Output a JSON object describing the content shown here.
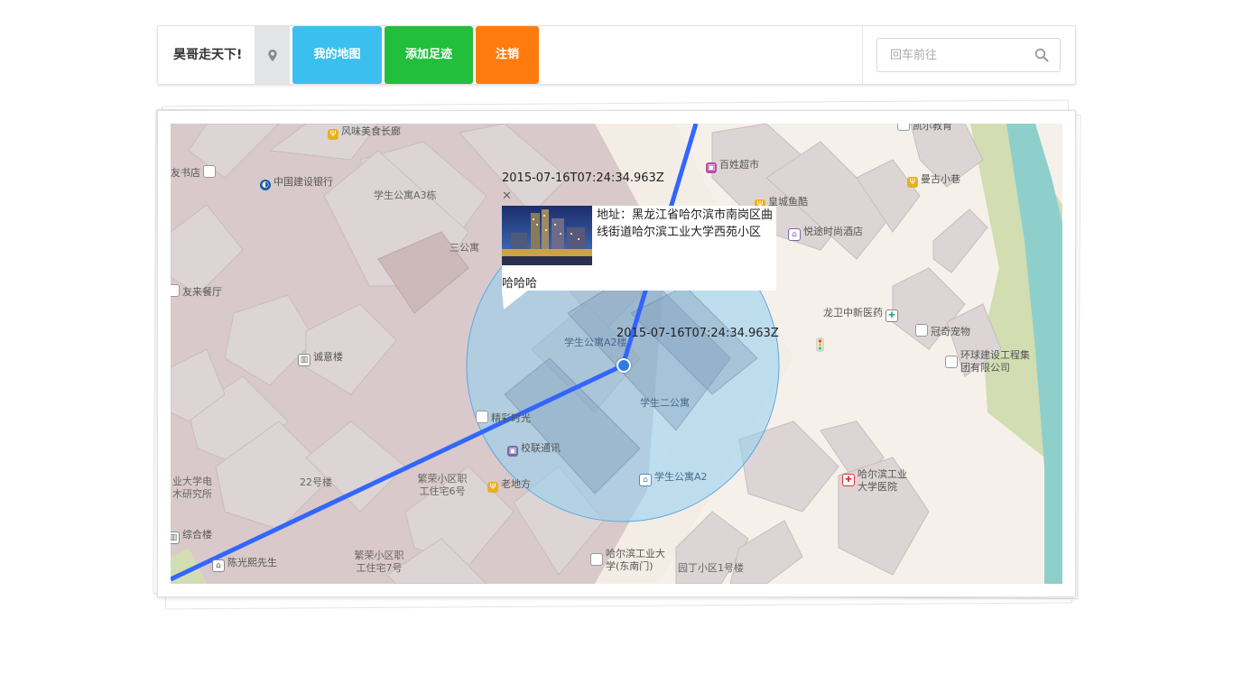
{
  "navbar": {
    "brand": "昊哥走天下!",
    "location_icon": "map-marker-icon",
    "buttons": {
      "my_map": "我的地图",
      "add_footprint": "添加足迹",
      "logout": "注销"
    },
    "button_colors": {
      "my_map": "#3bbfef",
      "add_footprint": "#22bf3c",
      "logout": "#ff7b0d"
    },
    "search": {
      "placeholder": "回车前往",
      "value": "",
      "icon": "search-icon"
    }
  },
  "map": {
    "info_window": {
      "title": "2015-07-16T07:24:34.963Z",
      "close_icon": "close-icon",
      "address": "地址：黑龙江省哈尔滨市南岗区曲线街道哈尔滨工业大学西苑小区",
      "note": "哈哈哈"
    },
    "point_label": "2015-07-16T07:24:34.963Z",
    "route_color": "#3366ff",
    "accuracy_circle_color": "#8fd0f0",
    "pois": [
      {
        "id": "fengwei",
        "label": "风味美食长廊",
        "icon": "restaurant-icon"
      },
      {
        "id": "youshudian",
        "label": "友书店",
        "icon": "poi-dot-icon"
      },
      {
        "id": "jianshe",
        "label": "中国建设银行",
        "icon": "bank-icon"
      },
      {
        "id": "xuesheng-a3",
        "label": "学生公寓A3栋",
        "icon": ""
      },
      {
        "id": "sangongyu",
        "label": "三公寓",
        "icon": ""
      },
      {
        "id": "youlai",
        "label": "友来餐厅",
        "icon": "restaurant-icon"
      },
      {
        "id": "chengyi",
        "label": "诚意楼",
        "icon": "building-icon"
      },
      {
        "id": "baixing",
        "label": "百姓超市",
        "icon": "shop-icon"
      },
      {
        "id": "huangcheng",
        "label": "皇城鱼酷",
        "icon": "restaurant-icon"
      },
      {
        "id": "yuetu",
        "label": "悦途时尚酒店",
        "icon": "hotel-icon"
      },
      {
        "id": "mangu",
        "label": "曼古小巷",
        "icon": "restaurant-icon"
      },
      {
        "id": "longwei",
        "label": "龙卫中新医药",
        "icon": "pharmacy-icon"
      },
      {
        "id": "guanqi",
        "label": "冠奇宠物",
        "icon": "poi-dot-icon"
      },
      {
        "id": "huanqiu",
        "label": "环球建设工程集团有限公司",
        "icon": "poi-dot-icon"
      },
      {
        "id": "xuesheng-a2-area",
        "label": "学生公寓A2楼",
        "icon": ""
      },
      {
        "id": "xuesheng-2",
        "label": "学生二公寓",
        "icon": ""
      },
      {
        "id": "jingcai",
        "label": "精彩时光",
        "icon": "poi-dot-icon"
      },
      {
        "id": "xiaolian",
        "label": "校联通讯",
        "icon": "shop-icon"
      },
      {
        "id": "laodifang",
        "label": "老地方",
        "icon": "restaurant-icon"
      },
      {
        "id": "xuesheng-a2",
        "label": "学生公寓A2",
        "icon": "home-icon"
      },
      {
        "id": "dadian",
        "label": "业大学电木研究所",
        "icon": ""
      },
      {
        "id": "22hao",
        "label": "22号楼",
        "icon": ""
      },
      {
        "id": "fanrong6",
        "label": "繁荣小区职工住宅6号",
        "icon": ""
      },
      {
        "id": "zonghe",
        "label": "综合楼",
        "icon": "building-icon"
      },
      {
        "id": "chenguangxi",
        "label": "陈光熙先生",
        "icon": "museum-icon"
      },
      {
        "id": "fanrong7",
        "label": "繁荣小区职工住宅7号",
        "icon": ""
      },
      {
        "id": "gongda-dongnan",
        "label": "哈尔滨工业大学(东南门)",
        "icon": "poi-dot-icon"
      },
      {
        "id": "yuanding",
        "label": "园丁小区1号楼",
        "icon": ""
      },
      {
        "id": "yiyuan",
        "label": "哈尔滨工业大学医院",
        "icon": "hospital-icon"
      },
      {
        "id": "jiaoyu",
        "label": "凯尔教育",
        "icon": "poi-dot-icon"
      }
    ]
  }
}
